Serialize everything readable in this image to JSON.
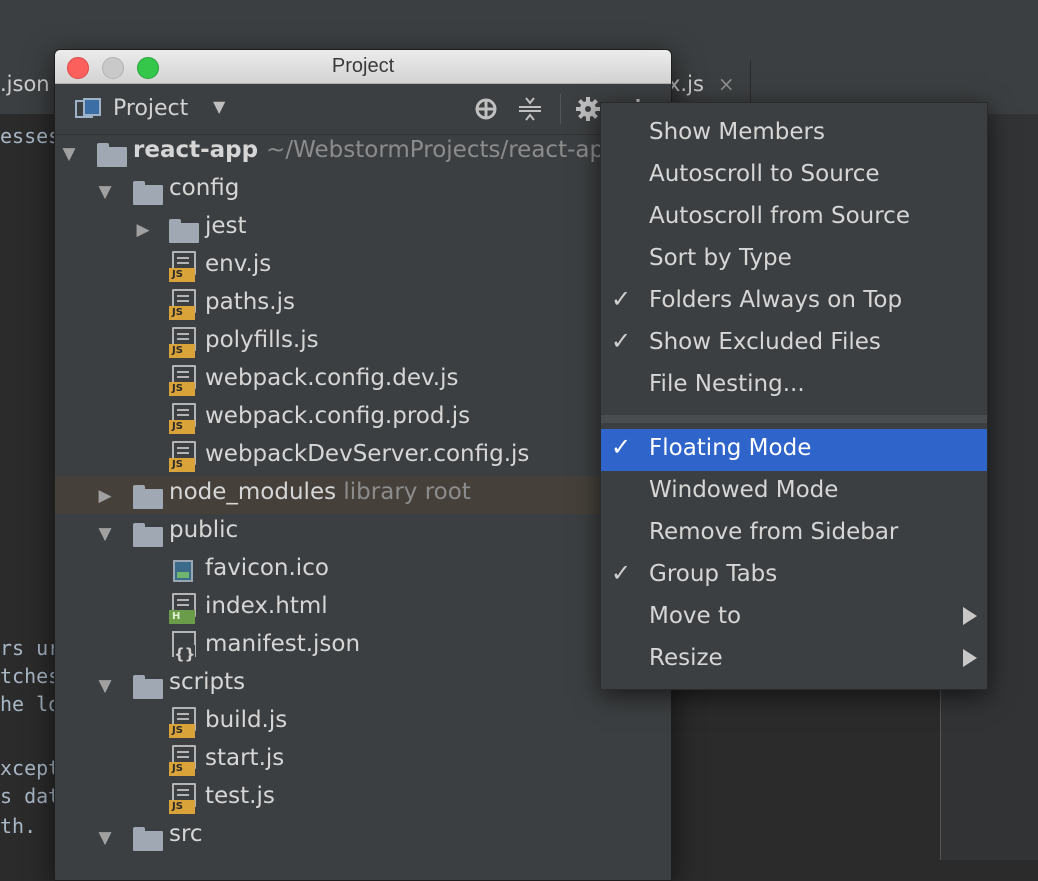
{
  "background": {
    "left_tab": ".json",
    "right_tab": "x.js",
    "right_tab_close": "×",
    "code_lines": [
      {
        "id": "c1",
        "text": "esses"
      },
      {
        "id": "c2",
        "text": "rs ur"
      },
      {
        "id": "c3",
        "text": "tches"
      },
      {
        "id": "c4",
        "text": "he lo"
      },
      {
        "id": "c5",
        "text": "xcept"
      },
      {
        "id": "c6",
        "text": "s dat"
      },
      {
        "id": "c7",
        "text": "th."
      }
    ]
  },
  "window": {
    "title": "Project",
    "view_label": "Project",
    "view_caret": "▼"
  },
  "tree": [
    {
      "label": "react-app",
      "hint": "~/WebstormProjects/react-app",
      "type": "folder",
      "depth": 0,
      "expanded": true,
      "bold": true
    },
    {
      "label": "config",
      "type": "folder",
      "depth": 1,
      "expanded": true
    },
    {
      "label": "jest",
      "type": "folder",
      "depth": 2,
      "expanded": false
    },
    {
      "label": "env.js",
      "type": "js",
      "depth": 2
    },
    {
      "label": "paths.js",
      "type": "js",
      "depth": 2
    },
    {
      "label": "polyfills.js",
      "type": "js",
      "depth": 2
    },
    {
      "label": "webpack.config.dev.js",
      "type": "js",
      "depth": 2
    },
    {
      "label": "webpack.config.prod.js",
      "type": "js",
      "depth": 2
    },
    {
      "label": "webpackDevServer.config.js",
      "type": "js",
      "depth": 2
    },
    {
      "label": "node_modules",
      "hint": "library root",
      "type": "folder",
      "depth": 1,
      "expanded": false,
      "selected": true
    },
    {
      "label": "public",
      "type": "folder",
      "depth": 1,
      "expanded": true
    },
    {
      "label": "favicon.ico",
      "type": "image",
      "depth": 2
    },
    {
      "label": "index.html",
      "type": "html",
      "depth": 2
    },
    {
      "label": "manifest.json",
      "type": "json",
      "depth": 2
    },
    {
      "label": "scripts",
      "type": "folder",
      "depth": 1,
      "expanded": true
    },
    {
      "label": "build.js",
      "type": "js",
      "depth": 2
    },
    {
      "label": "start.js",
      "type": "js",
      "depth": 2
    },
    {
      "label": "test.js",
      "type": "js",
      "depth": 2
    },
    {
      "label": "src",
      "type": "folder",
      "depth": 1,
      "expanded": true
    }
  ],
  "icons": {
    "js_badge": "JS",
    "html_badge": "H",
    "json_braces": "{}",
    "expanded_arrow": "▼",
    "collapsed_arrow": "▶",
    "check": "✓"
  },
  "menu": {
    "items": [
      {
        "label": "Show Members",
        "checked": false
      },
      {
        "label": "Autoscroll to Source",
        "checked": false
      },
      {
        "label": "Autoscroll from Source",
        "checked": false
      },
      {
        "label": "Sort by Type",
        "checked": false
      },
      {
        "label": "Folders Always on Top",
        "checked": true
      },
      {
        "label": "Show Excluded Files",
        "checked": true
      },
      {
        "label": "File Nesting...",
        "checked": false
      }
    ],
    "items2": [
      {
        "label": "Floating Mode",
        "checked": true,
        "active": true
      },
      {
        "label": "Windowed Mode",
        "checked": false
      },
      {
        "label": "Remove from Sidebar",
        "checked": false
      },
      {
        "label": "Group Tabs",
        "checked": true
      },
      {
        "label": "Move to",
        "checked": false,
        "submenu": true
      },
      {
        "label": "Resize",
        "checked": false,
        "submenu": true
      }
    ]
  },
  "colors": {
    "accent": "#2f65ca",
    "js_badge": "#d9a339",
    "html_badge": "#6a9c4a",
    "selected_row": "#45403a"
  }
}
